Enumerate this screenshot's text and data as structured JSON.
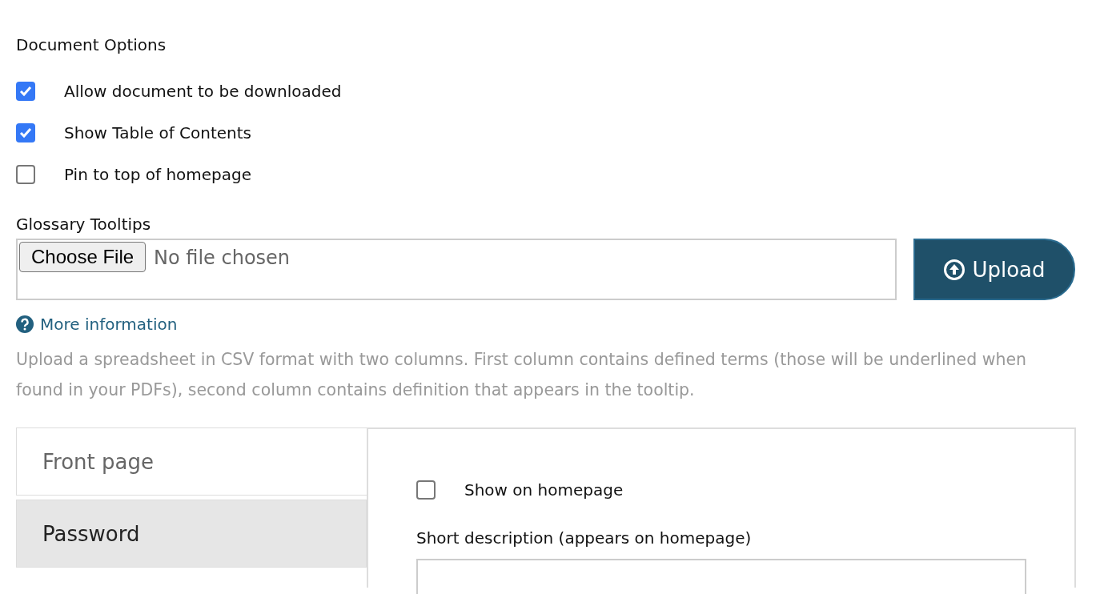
{
  "document_options": {
    "title": "Document Options",
    "options": [
      {
        "label": "Allow document to be downloaded",
        "checked": true
      },
      {
        "label": "Show Table of Contents",
        "checked": true
      },
      {
        "label": "Pin to top of homepage",
        "checked": false
      }
    ]
  },
  "glossary": {
    "label": "Glossary Tooltips",
    "choose_button": "Choose File",
    "file_status": "No file chosen",
    "upload_button": "Upload",
    "more_info_link": "More information",
    "help_text": "Upload a spreadsheet in CSV format with two columns. First column contains defined terms (those will be underlined when found in your PDFs), second column contains definition that appears in the tooltip."
  },
  "tabs": [
    {
      "label": "Front page",
      "selected": true
    },
    {
      "label": "Password",
      "selected": false
    }
  ],
  "panel": {
    "show_on_homepage": {
      "label": "Show on homepage",
      "checked": false
    },
    "short_description_label": "Short description (appears on homepage)"
  }
}
